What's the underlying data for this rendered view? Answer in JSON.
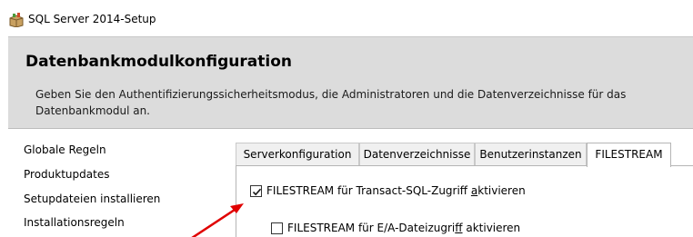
{
  "window": {
    "title": "SQL Server 2014-Setup",
    "app_icon": "sql-setup-box-icon"
  },
  "header": {
    "title": "Datenbankmodulkonfiguration",
    "description": "Geben Sie den Authentifizierungssicherheitsmodus, die Administratoren und die Datenverzeichnisse für das Datenbankmodul an."
  },
  "sidebar": {
    "items": [
      {
        "label": "Globale Regeln"
      },
      {
        "label": "Produktupdates"
      },
      {
        "label": "Setupdateien installieren"
      },
      {
        "label": "Installationsregeln"
      }
    ]
  },
  "tabs": [
    {
      "label": "Serverkonfiguration"
    },
    {
      "label": "Datenverzeichnisse"
    },
    {
      "label": "Benutzerinstanzen"
    },
    {
      "label": "FILESTREAM",
      "active": true
    }
  ],
  "filestream": {
    "tsql_pre": "FILESTREAM für Transact-SQL-Zugriff ",
    "tsql_accel": "a",
    "tsql_post": "ktivieren",
    "tsql_checked": true,
    "io_pre": "FILESTREAM für E/A-Dateizugri",
    "io_accel": "f",
    "io_post": "f aktivieren",
    "io_checked": false
  },
  "colors": {
    "header_bg": "#dcdcdc",
    "annotation_arrow": "#e00000"
  }
}
